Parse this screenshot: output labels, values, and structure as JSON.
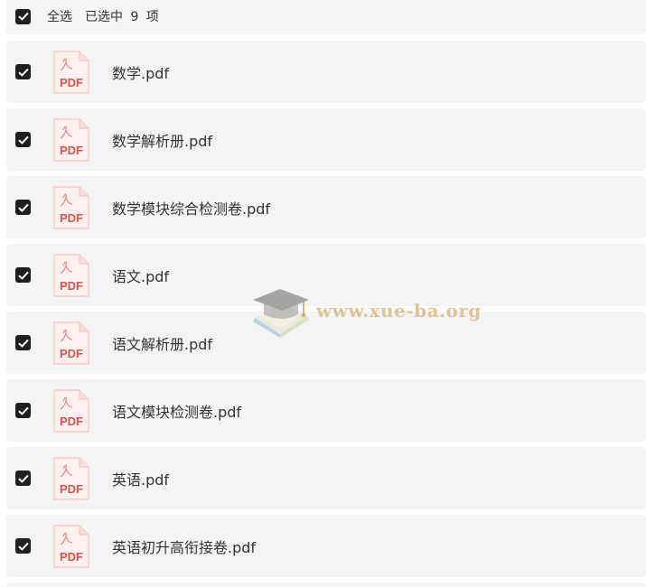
{
  "select_bar": {
    "select_all_label": "全选",
    "selected_text": "已选中 9 项"
  },
  "files": [
    {
      "name": "数学.pdf",
      "checked": true,
      "icon": "pdf-icon",
      "icon_label": "PDF"
    },
    {
      "name": "数学解析册.pdf",
      "checked": true,
      "icon": "pdf-icon",
      "icon_label": "PDF"
    },
    {
      "name": "数学模块综合检测卷.pdf",
      "checked": true,
      "icon": "pdf-icon",
      "icon_label": "PDF"
    },
    {
      "name": "语文.pdf",
      "checked": true,
      "icon": "pdf-icon",
      "icon_label": "PDF"
    },
    {
      "name": "语文解析册.pdf",
      "checked": true,
      "icon": "pdf-icon",
      "icon_label": "PDF"
    },
    {
      "name": "语文模块检测卷.pdf",
      "checked": true,
      "icon": "pdf-icon",
      "icon_label": "PDF"
    },
    {
      "name": "英语.pdf",
      "checked": true,
      "icon": "pdf-icon",
      "icon_label": "PDF"
    },
    {
      "name": "英语初升高衔接卷.pdf",
      "checked": true,
      "icon": "pdf-icon",
      "icon_label": "PDF"
    }
  ],
  "watermark": {
    "text": "www.xue-ba.org"
  },
  "colors": {
    "row_background": "#f4f4f5",
    "checkbox": "#1f1f1f",
    "pdf_red": "#d9534f",
    "pdf_bg": "#fdf1f0",
    "watermark": "#d6ba8c"
  }
}
